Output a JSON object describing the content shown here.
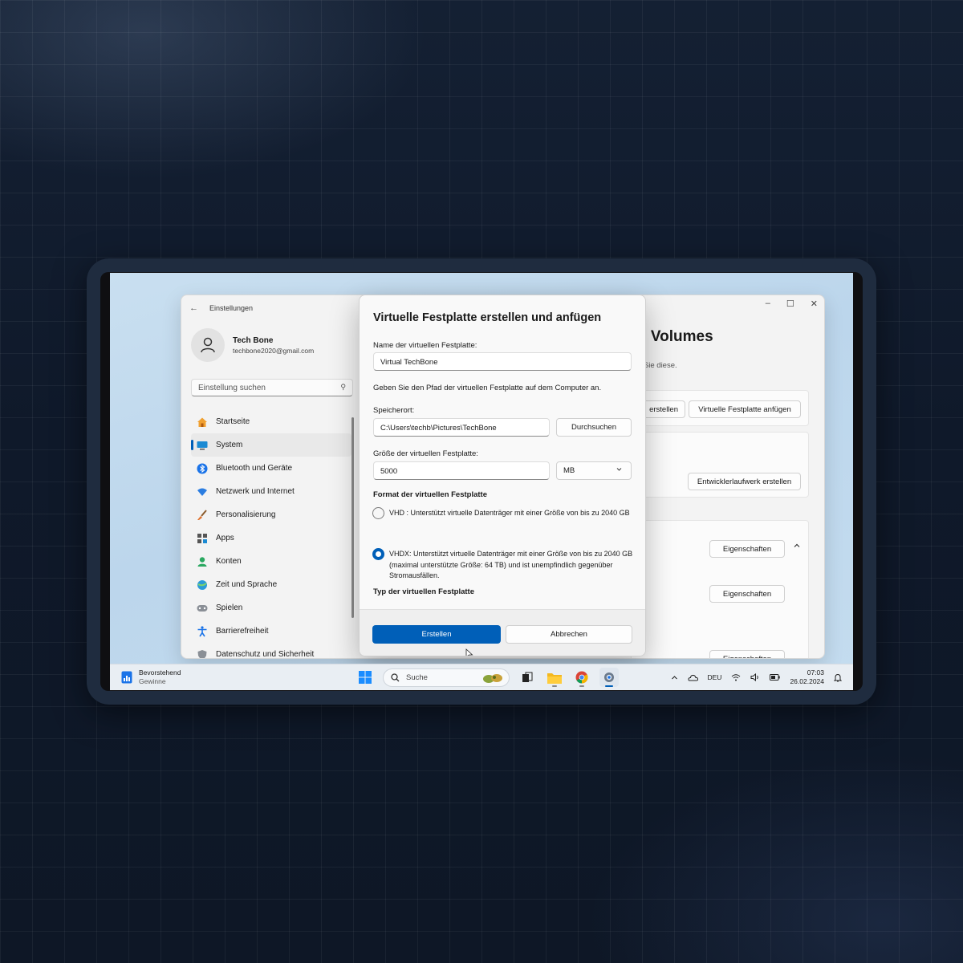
{
  "colors": {
    "accent": "#005fb8",
    "background": "#0f1a2b",
    "desktop": "#c4dcef"
  },
  "settings": {
    "title": "Einstellungen",
    "window_controls": {
      "minimize": "–",
      "maximize": "☐",
      "close": "✕"
    },
    "profile": {
      "name": "Tech Bone",
      "email": "techbone2020@gmail.com"
    },
    "search_placeholder": "Einstellung suchen",
    "nav": [
      {
        "label": "Startseite",
        "icon": "home-icon",
        "active": false
      },
      {
        "label": "System",
        "icon": "system-icon",
        "active": true
      },
      {
        "label": "Bluetooth und Geräte",
        "icon": "bluetooth-icon",
        "active": false
      },
      {
        "label": "Netzwerk und Internet",
        "icon": "network-icon",
        "active": false
      },
      {
        "label": "Personalisierung",
        "icon": "brush-icon",
        "active": false
      },
      {
        "label": "Apps",
        "icon": "apps-icon",
        "active": false
      },
      {
        "label": "Konten",
        "icon": "account-icon",
        "active": false
      },
      {
        "label": "Zeit und Sprache",
        "icon": "globe-clock-icon",
        "active": false
      },
      {
        "label": "Spielen",
        "icon": "gamepad-icon",
        "active": false
      },
      {
        "label": "Barrierefreiheit",
        "icon": "accessibility-icon",
        "active": false
      },
      {
        "label": "Datenschutz und Sicherheit",
        "icon": "shield-icon",
        "active": false
      }
    ],
    "content": {
      "title_fragment": "d Volumes",
      "subtitle_fragment": "n Sie diese.",
      "btn_create_fragment": "erstellen",
      "btn_attach_vhd": "Virtuelle Festplatte anfügen",
      "btn_dev_drive": "Entwicklerlaufwerk erstellen",
      "btn_properties_1": "Eigenschaften",
      "btn_properties_2": "Eigenschaften",
      "btn_properties_3": "Eigenschaften",
      "chevron_up": "^"
    }
  },
  "dialog": {
    "title": "Virtuelle Festplatte erstellen und anfügen",
    "name_label": "Name der virtuellen Festplatte:",
    "name_value": "Virtual TechBone",
    "path_hint": "Geben Sie den Pfad der virtuellen Festplatte auf dem Computer an.",
    "location_label": "Speicherort:",
    "location_value": "C:\\Users\\techb\\Pictures\\TechBone",
    "browse_button": "Durchsuchen",
    "size_label": "Größe der virtuellen Festplatte:",
    "size_value": "5000",
    "size_unit": "MB",
    "format_heading": "Format der virtuellen Festplatte",
    "format_options": [
      {
        "label": "VHD : Unterstützt virtuelle Datenträger mit einer Größe von bis zu 2040 GB",
        "selected": false
      },
      {
        "label": "VHDX: Unterstützt virtuelle Datenträger mit einer Größe von bis zu 2040 GB (maximal unterstützte Größe: 64 TB) und ist unempfindlich gegenüber Stromausfällen.",
        "selected": true
      }
    ],
    "type_heading": "Typ der virtuellen Festplatte",
    "create_button": "Erstellen",
    "cancel_button": "Abbrechen"
  },
  "taskbar": {
    "weather_title": "Bevorstehend",
    "weather_sub": "Gewinne",
    "search_label": "Suche",
    "tray": {
      "language": "DEU",
      "time": "07:03",
      "date": "26.02.2024"
    }
  }
}
